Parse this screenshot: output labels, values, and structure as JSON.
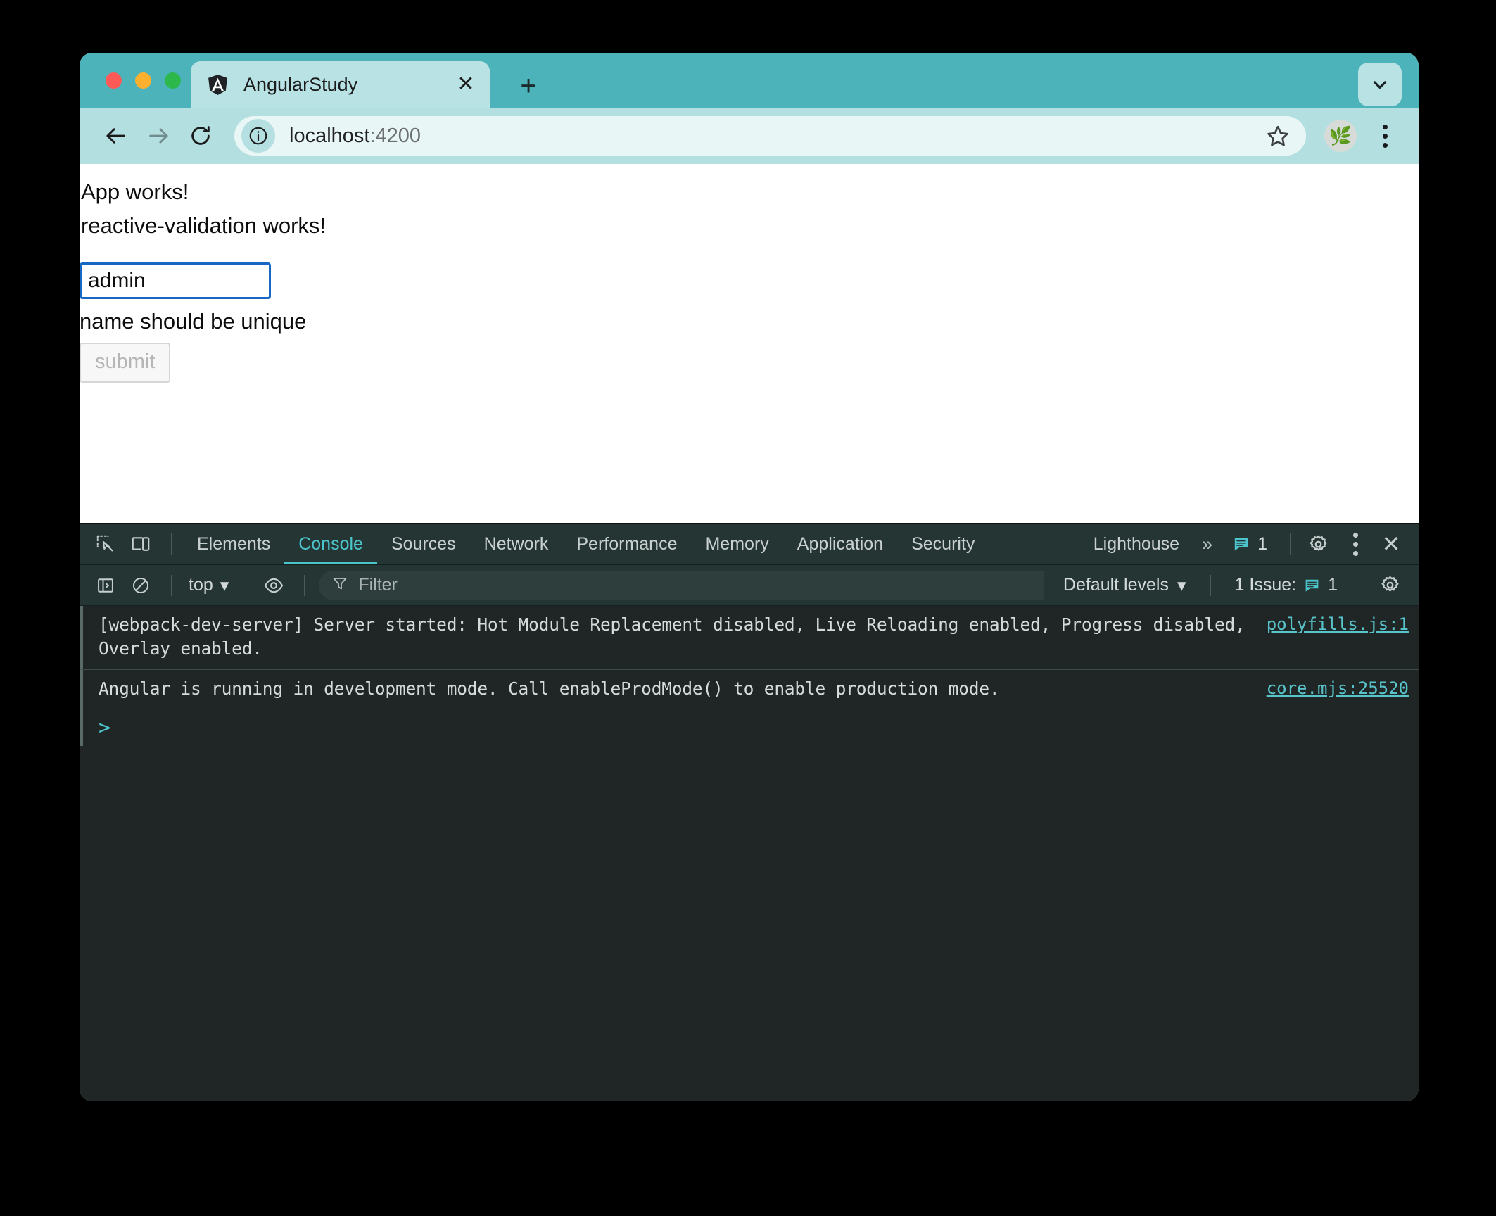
{
  "window": {
    "traffic_lights": [
      "close",
      "minimize",
      "zoom"
    ],
    "colors": {
      "tabstrip": "#4cb3bb",
      "toolbar": "#b3dfe1",
      "active_tab": "#b9e2e4",
      "devtools_bg": "#202625",
      "devtools_bar": "#253533",
      "accent": "#4cc4cc",
      "link": "#58c5cc",
      "focus_border": "#1767c7"
    }
  },
  "browser": {
    "tab": {
      "title": "AngularStudy",
      "favicon": "angular-icon",
      "close_label": "✕"
    },
    "new_tab_label": "+",
    "tab_list_chevron": "chevron-down-icon",
    "nav": {
      "back": "back-arrow-icon",
      "forward": "forward-arrow-icon",
      "reload": "reload-icon"
    },
    "omnibox": {
      "site_info_icon": "info-circle-icon",
      "url_host": "localhost",
      "url_port": ":4200",
      "bookmark_icon": "star-icon"
    },
    "profile_avatar": "🌿",
    "menu_icon": "kebab-menu-icon"
  },
  "page": {
    "heading_app": "App works!",
    "heading_component": "reactive-validation works!",
    "name_input_value": "admin",
    "name_input_placeholder": "",
    "validation_message": "name should be unique",
    "submit_label": "submit",
    "submit_disabled": true
  },
  "devtools": {
    "toolbar_icons": {
      "inspect": "inspect-element-icon",
      "device": "device-toolbar-icon"
    },
    "tabs": [
      {
        "label": "Elements",
        "active": false
      },
      {
        "label": "Console",
        "active": true
      },
      {
        "label": "Sources",
        "active": false
      },
      {
        "label": "Network",
        "active": false
      },
      {
        "label": "Performance",
        "active": false
      },
      {
        "label": "Memory",
        "active": false
      },
      {
        "label": "Application",
        "active": false
      },
      {
        "label": "Security",
        "active": false
      },
      {
        "label": "Lighthouse",
        "active": false
      }
    ],
    "more_tabs_label": "»",
    "issues_count": "1",
    "settings_icon": "gear-icon",
    "more_options_icon": "kebab-menu-icon",
    "close_icon": "close-icon",
    "console_toolbar": {
      "sidebar_icon": "console-sidebar-icon",
      "clear_icon": "clear-console-icon",
      "context": "top",
      "context_chevron": "▾",
      "eye_icon": "live-expression-icon",
      "filter_icon": "filter-icon",
      "filter_placeholder": "Filter",
      "levels_label": "Default levels",
      "levels_chevron": "▾",
      "issues_label": "1 Issue:",
      "issues_count": "1",
      "settings_icon": "gear-icon"
    },
    "logs": [
      {
        "text": "[webpack-dev-server] Server started: Hot Module Replacement disabled, Live Reloading enabled, Progress disabled,\nOverlay enabled.",
        "source": "polyfills.js:1"
      },
      {
        "text": "Angular is running in development mode. Call enableProdMode() to enable production mode.",
        "source": "core.mjs:25520"
      }
    ],
    "prompt_symbol": ">"
  }
}
